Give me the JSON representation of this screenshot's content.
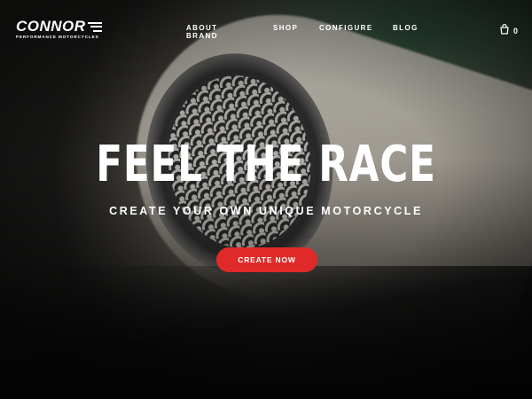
{
  "brand": {
    "name": "CONNOR",
    "tagline": "PERFORMANCE MOTORCYCLES"
  },
  "nav": {
    "items": [
      {
        "label": "ABOUT BRAND"
      },
      {
        "label": "SHOP"
      },
      {
        "label": "CONFIGURE"
      },
      {
        "label": "BLOG"
      }
    ]
  },
  "cart": {
    "count": "0",
    "icon": "shopping-bag-icon"
  },
  "hero": {
    "headline": "FEEL THE RACE",
    "subheadline": "CREATE YOUR OWN UNIQUE MOTORCYCLE",
    "cta_label": "CREATE NOW",
    "background_image": "motorcycle exhaust close-up"
  },
  "colors": {
    "accent": "#e02a2a",
    "text": "#ffffff"
  }
}
